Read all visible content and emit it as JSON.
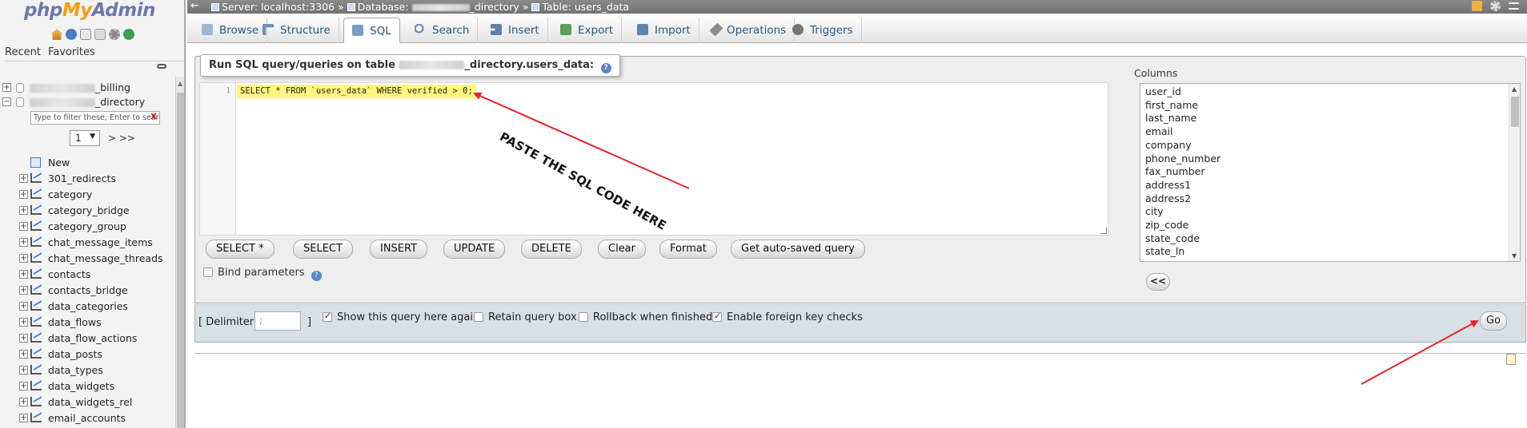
{
  "nav": {
    "logo_php": "php",
    "logo_my": "My",
    "logo_admin": "Admin",
    "tab_recent": "Recent",
    "tab_favorites": "Favorites",
    "databases": [
      {
        "suffix": "_billing",
        "expander": "+"
      },
      {
        "suffix": "_directory",
        "expander": "−"
      }
    ],
    "filter_placeholder": "Type to filter these, Enter to search",
    "filter_clear": "X",
    "page_select": "1",
    "page_next": "> >>",
    "new_label": "New",
    "tables": [
      "301_redirects",
      "category",
      "category_bridge",
      "category_group",
      "chat_message_items",
      "chat_message_threads",
      "contacts",
      "contacts_bridge",
      "data_categories",
      "data_flows",
      "data_flow_actions",
      "data_posts",
      "data_types",
      "data_widgets",
      "data_widgets_rel",
      "email_accounts"
    ]
  },
  "topbar": {
    "server": "Server: localhost:3306",
    "sep1": "»",
    "database_prefix": "Database:",
    "database_suffix": "_directory",
    "sep2": "»",
    "table": "Table: users_data"
  },
  "tabs": [
    {
      "label": "Browse",
      "icon": "browse-icon"
    },
    {
      "label": "Structure",
      "icon": "structure-icon"
    },
    {
      "label": "SQL",
      "icon": "sql-icon",
      "active": true
    },
    {
      "label": "Search",
      "icon": "search-icon"
    },
    {
      "label": "Insert",
      "icon": "insert-icon"
    },
    {
      "label": "Export",
      "icon": "export-icon"
    },
    {
      "label": "Import",
      "icon": "import-icon"
    },
    {
      "label": "Operations",
      "icon": "operations-icon"
    },
    {
      "label": "Triggers",
      "icon": "triggers-icon"
    }
  ],
  "sql": {
    "legend_prefix": "Run SQL query/queries on table",
    "legend_suffix": "_directory.users_data:",
    "line_number": "1",
    "query": "SELECT * FROM `users_data` WHERE verified > 0;",
    "annotation": "PASTE THE SQL CODE HERE",
    "annotation_color": "#e8232b",
    "buttons": [
      "SELECT *",
      "SELECT",
      "INSERT",
      "UPDATE",
      "DELETE",
      "Clear",
      "Format",
      "Get auto-saved query"
    ],
    "bind_parameters": "Bind parameters",
    "columns_label": "Columns",
    "columns": [
      "user_id",
      "first_name",
      "last_name",
      "email",
      "company",
      "phone_number",
      "fax_number",
      "address1",
      "address2",
      "city",
      "zip_code",
      "state_code",
      "state_ln"
    ],
    "insert_column_button": "<<"
  },
  "footer": {
    "delimiter_open": "[ Delimiter",
    "delimiter_value": ";",
    "delimiter_close": "]",
    "show_query_again": "Show this query here again",
    "show_query_again_checked": true,
    "retain_query_box": "Retain query box",
    "retain_query_box_checked": false,
    "rollback": "Rollback when finished",
    "rollback_checked": false,
    "foreign_keys": "Enable foreign key checks",
    "foreign_keys_checked": true,
    "go": "Go"
  },
  "colors": {
    "link_blue": "#235a81",
    "highlight_yellow": "#fff77d",
    "annotation_red": "#e8232b"
  }
}
